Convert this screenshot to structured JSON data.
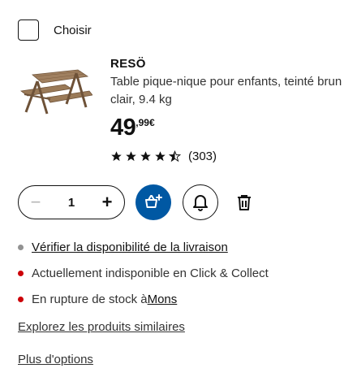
{
  "select": {
    "label": "Choisir"
  },
  "product": {
    "name": "RESÖ",
    "description": "Table pique-nique pour enfants, teinté brun clair, 9.4 kg",
    "price_integer": "49",
    "price_decimal": ",99€",
    "rating_count": "(303)",
    "rating_stars": 4.5
  },
  "quantity": {
    "minus": "−",
    "value": "1",
    "plus": "+"
  },
  "status": [
    {
      "text": "Vérifier la disponibilité de la livraison",
      "color": "#929292"
    },
    {
      "text": "Actuellement indisponible en Click & Collect",
      "color": "#cc0008"
    },
    {
      "prefix": "En rupture de stock à ",
      "link": "Mons",
      "color": "#cc0008"
    }
  ],
  "links": {
    "similar": "Explorez les produits similaires",
    "more": "Plus d'options"
  },
  "colors": {
    "accent": "#0058a3"
  }
}
